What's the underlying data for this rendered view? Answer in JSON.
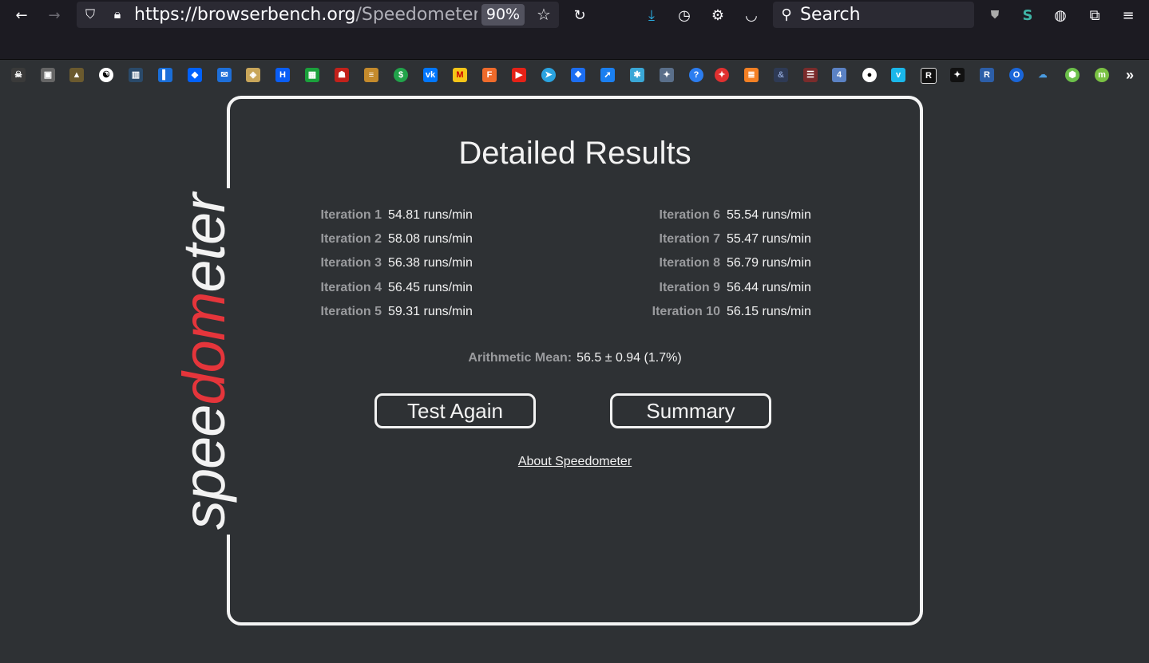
{
  "browser": {
    "url_host": "https://browserbench.org",
    "url_path": "/Speedometer",
    "zoom": "90%",
    "search_placeholder": "Search"
  },
  "page": {
    "logo_text_pre": "spee",
    "logo_text_red": "dom",
    "logo_text_post": "eter",
    "title": "Detailed Results",
    "iterations": [
      {
        "label": "Iteration 1",
        "value": "54.81 runs/min"
      },
      {
        "label": "Iteration 2",
        "value": "58.08 runs/min"
      },
      {
        "label": "Iteration 3",
        "value": "56.38 runs/min"
      },
      {
        "label": "Iteration 4",
        "value": "56.45 runs/min"
      },
      {
        "label": "Iteration 5",
        "value": "59.31 runs/min"
      },
      {
        "label": "Iteration 6",
        "value": "55.54 runs/min"
      },
      {
        "label": "Iteration 7",
        "value": "55.47 runs/min"
      },
      {
        "label": "Iteration 8",
        "value": "56.79 runs/min"
      },
      {
        "label": "Iteration 9",
        "value": "56.44 runs/min"
      },
      {
        "label": "Iteration 10",
        "value": "56.15 runs/min"
      }
    ],
    "mean_label": "Arithmetic Mean:",
    "mean_value": "56.5 ± 0.94 (1.7%)",
    "test_again_label": "Test Again",
    "summary_label": "Summary",
    "about_link": "About Speedometer"
  },
  "colors": {
    "background": "#2e3134",
    "accent_red": "#e5353b",
    "foreground": "#f2f2f2"
  }
}
